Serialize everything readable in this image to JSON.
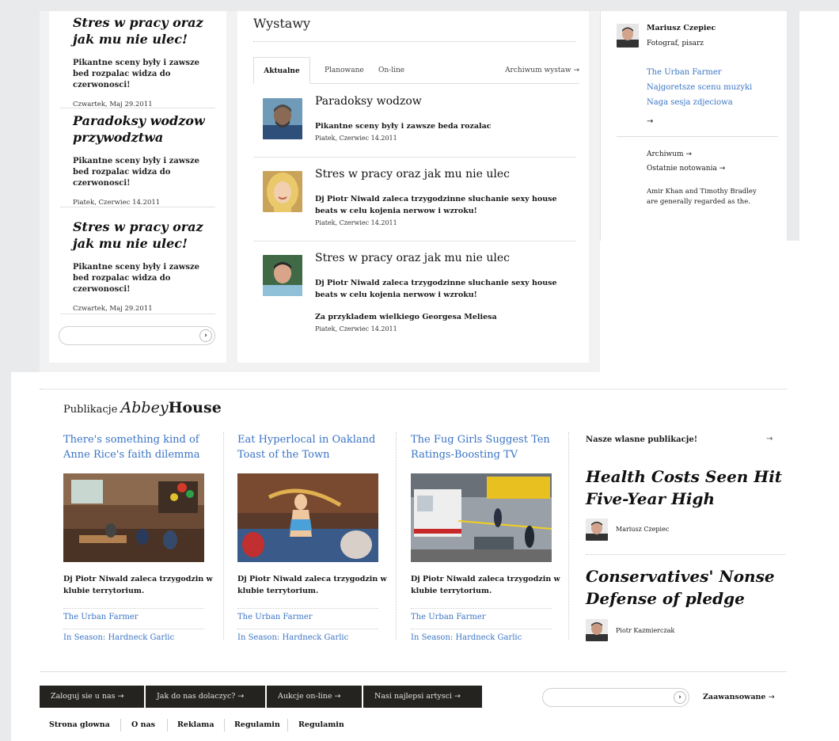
{
  "left_stories": [
    {
      "title": "Stres w pracy oraz jak mu nie ulec!",
      "excerpt": "Pikantne sceny były i zawsze bed rozpalac widza do czerwonosci!",
      "date": "Czwartek, Maj 29.2011"
    },
    {
      "title": "Paradoksy wodzow przywodztwa",
      "excerpt": "Pikantne sceny były i zawsze bed rozpalac widza do czerwonosci!",
      "date": "Piatek, Czerwiec 14.2011"
    },
    {
      "title": "Stres w pracy oraz jak mu nie ulec!",
      "excerpt": "Pikantne sceny były i zawsze bed rozpalac widza do czerwonosci!",
      "date": "Czwartek, Maj 29.2011"
    }
  ],
  "exhibitions": {
    "title": "Wystawy",
    "tabs": [
      "Aktualne",
      "Planowane",
      "On-line"
    ],
    "archive_link": "Archiwum wystaw",
    "entries": [
      {
        "title": "Paradoksy wodzow",
        "text": "Pikantne sceny były i zawsze beda rozalac",
        "extra": "",
        "date": "Piatek, Czerwiec 14.2011"
      },
      {
        "title": "Stres w pracy oraz jak mu nie ulec",
        "text": "Dj Piotr Niwald zaleca trzygodzinne sluchanie sexy house beats w celu kojenia nerwow i wzroku!",
        "extra": "",
        "date": "Piatek, Czerwiec 14.2011"
      },
      {
        "title": "Stres w pracy oraz jak mu nie ulec",
        "text": "Dj Piotr Niwald zaleca trzygodzinne sluchanie sexy house beats w celu kojenia nerwow i wzroku!",
        "extra": "Za przykladem wielkiego Georgesa Meliesa",
        "date": "Piatek, Czerwiec 14.2011"
      }
    ]
  },
  "author_card": {
    "name": "Mariusz Czepiec",
    "role": "Fotograf, pisarz",
    "links": [
      "The Urban Farmer",
      "Najgoretsze scenu muzyki",
      "Naga sesja zdjeciowa"
    ],
    "archive": "Archiwum",
    "latest": "Ostatnie notowania",
    "note": "Amir Khan and Timothy Bradley are generally regarded as the."
  },
  "publications": {
    "label": "Publikacje",
    "brand_italic": "Abbey",
    "brand_bold": "House",
    "columns": [
      {
        "title": "There's something kind of Anne Rice's faith dilemma",
        "text": "Dj Piotr Niwald zaleca trzygodzin w klubie terrytorium.",
        "link1": "The Urban Farmer",
        "link2": "In Season: Hardneck Garlic"
      },
      {
        "title": "Eat Hyperlocal in Oakland Toast of the Town",
        "text": "Dj Piotr Niwald zaleca trzygodzin w klubie terrytorium.",
        "link1": "The Urban Farmer",
        "link2": "In Season: Hardneck Garlic"
      },
      {
        "title": "The Fug Girls Suggest Ten Ratings-Boosting TV",
        "text": "Dj Piotr Niwald zaleca trzygodzin w klubie terrytorium.",
        "link1": "The Urban Farmer",
        "link2": "In Season: Hardneck Garlic"
      }
    ],
    "own_heading": "Nasze wlasne publikacje!",
    "own": [
      {
        "title": "Health Costs Seen Hit Five-Year High",
        "author": "Mariusz Czepiec"
      },
      {
        "title": "Conservatives' Nonse Defense of pledge",
        "author": "Piotr Kazmierczak"
      }
    ]
  },
  "footer": {
    "buttons": [
      "Zaloguj sie u nas",
      "Jak do nas dolaczyc?",
      "Aukcje on-line",
      "Nasi najlepsi artysci"
    ],
    "advanced": "Zaawansowane",
    "links": [
      "Strona glowna",
      "O nas",
      "Reklama",
      "Regulamin",
      "Regulamin"
    ]
  },
  "icons": {
    "arrow": "→",
    "go": "›"
  }
}
